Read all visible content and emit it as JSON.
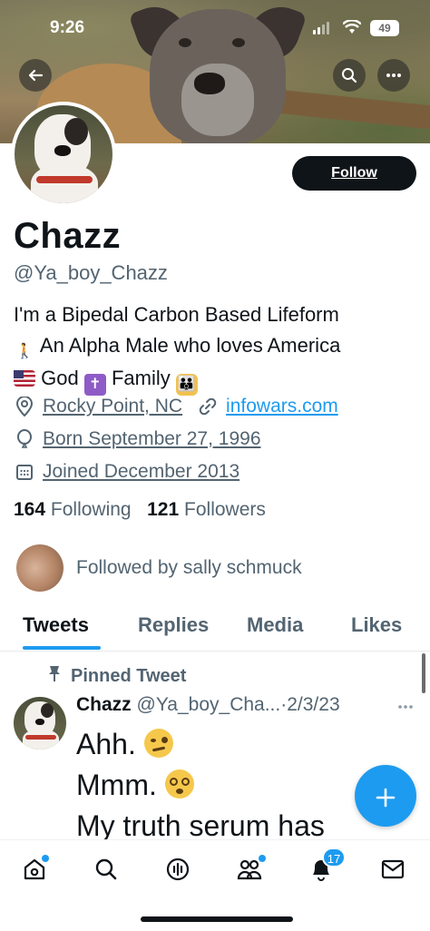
{
  "status_bar": {
    "time": "9:26",
    "battery": "49"
  },
  "profile": {
    "follow_label": "Follow",
    "name": "Chazz",
    "handle": "@Ya_boy_Chazz",
    "bio_lines": [
      "I'm a Bipedal Carbon Based Lifeform",
      "An Alpha Male who loves America",
      "God",
      "Family"
    ],
    "location": "Rocky Point, NC",
    "website": "infowars.com",
    "born": "Born September 27, 1996",
    "joined": "Joined December 2013",
    "following_count": "164",
    "following_label": "Following",
    "followers_count": "121",
    "followers_label": "Followers",
    "followed_by": "Followed by sally schmuck"
  },
  "tabs": [
    {
      "label": "Tweets",
      "active": true
    },
    {
      "label": "Replies",
      "active": false
    },
    {
      "label": "Media",
      "active": false
    },
    {
      "label": "Likes",
      "active": false
    }
  ],
  "pinned_tweet": {
    "pinned_label": "Pinned Tweet",
    "author_name": "Chazz",
    "author_handle": "@Ya_boy_Cha...",
    "separator": "·",
    "date": "2/3/23",
    "lines": [
      "Ahh.",
      "Mmm.",
      "My truth serum has"
    ]
  },
  "nav": {
    "notifications_badge": "17"
  },
  "colors": {
    "accent": "#1d9bf0",
    "text": "#0f1419",
    "muted": "#536471"
  },
  "icons": [
    "back-arrow-icon",
    "search-icon",
    "more-icon",
    "location-pin-icon",
    "link-icon",
    "balloon-icon",
    "calendar-icon",
    "pin-icon",
    "home-icon",
    "spaces-icon",
    "communities-icon",
    "bell-icon",
    "mail-icon",
    "plus-icon"
  ]
}
